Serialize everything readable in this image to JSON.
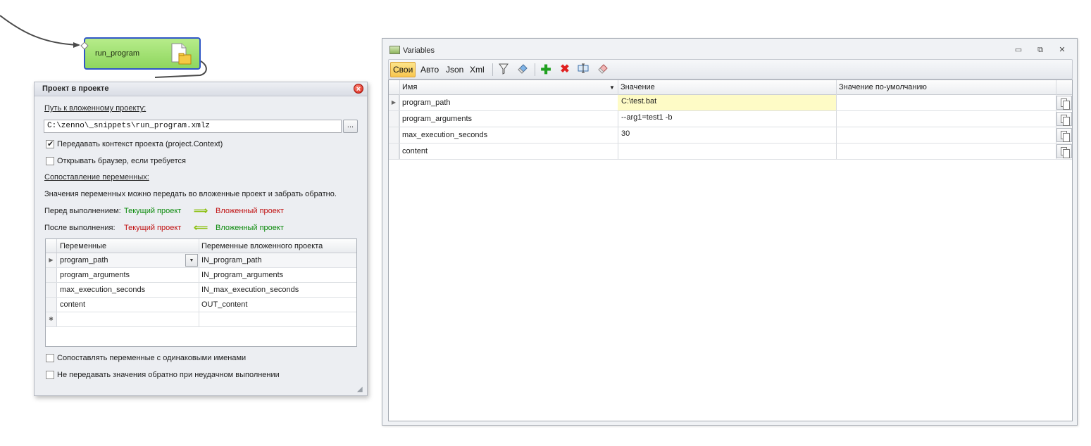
{
  "canvas": {
    "node_label": "run_program"
  },
  "dialog": {
    "title": "Проект в проекте",
    "path_label": "Путь к вложенному проекту:",
    "path_value": "C:\\zenno\\_snippets\\run_program.xmlz",
    "browse_label": "...",
    "pass_context_label": "Передавать контекст проекта (project.Context)",
    "pass_context_checked": true,
    "open_browser_label": "Открывать браузер, если требуется",
    "open_browser_checked": false,
    "mapping_label": "Сопоставление переменных:",
    "mapping_description": "Значения переменных можно передать во вложенные проект и забрать обратно.",
    "before_label": "Перед выполнением:",
    "after_label": "После выполнения:",
    "current_project": "Текущий проект",
    "nested_project": "Вложенный проект",
    "arrow_right": "⟹",
    "arrow_left": "⟸",
    "grid": {
      "headers": [
        "Переменные",
        "Переменные вложенного проекта"
      ],
      "rows": [
        {
          "var": "program_path",
          "nested": "IN_program_path"
        },
        {
          "var": "program_arguments",
          "nested": "IN_program_arguments"
        },
        {
          "var": "max_execution_seconds",
          "nested": "IN_max_execution_seconds"
        },
        {
          "var": "content",
          "nested": "OUT_content"
        }
      ],
      "new_row_marker": "✱"
    },
    "match_same_names_label": "Сопоставлять переменные с одинаковыми именами",
    "match_same_names_checked": false,
    "no_pass_back_label": "Не передавать значения обратно при неудачном выполнении",
    "no_pass_back_checked": false
  },
  "variables_window": {
    "title": "Variables",
    "controls": {
      "minimize": "▭",
      "restore": "⧉",
      "close": "✕"
    },
    "toolbar": {
      "own": "Свои",
      "auto": "Авто",
      "json": "Json",
      "xml": "Xml"
    },
    "grid": {
      "headers": {
        "name": "Имя",
        "value": "Значение",
        "default": "Значение по-умолчанию"
      },
      "rows": [
        {
          "name": "program_path",
          "value": "C:\\test.bat",
          "default": ""
        },
        {
          "name": "program_arguments",
          "value": "--arg1=test1  -b",
          "default": ""
        },
        {
          "name": "max_execution_seconds",
          "value": "30",
          "default": ""
        },
        {
          "name": "content",
          "value": "",
          "default": ""
        }
      ]
    }
  }
}
